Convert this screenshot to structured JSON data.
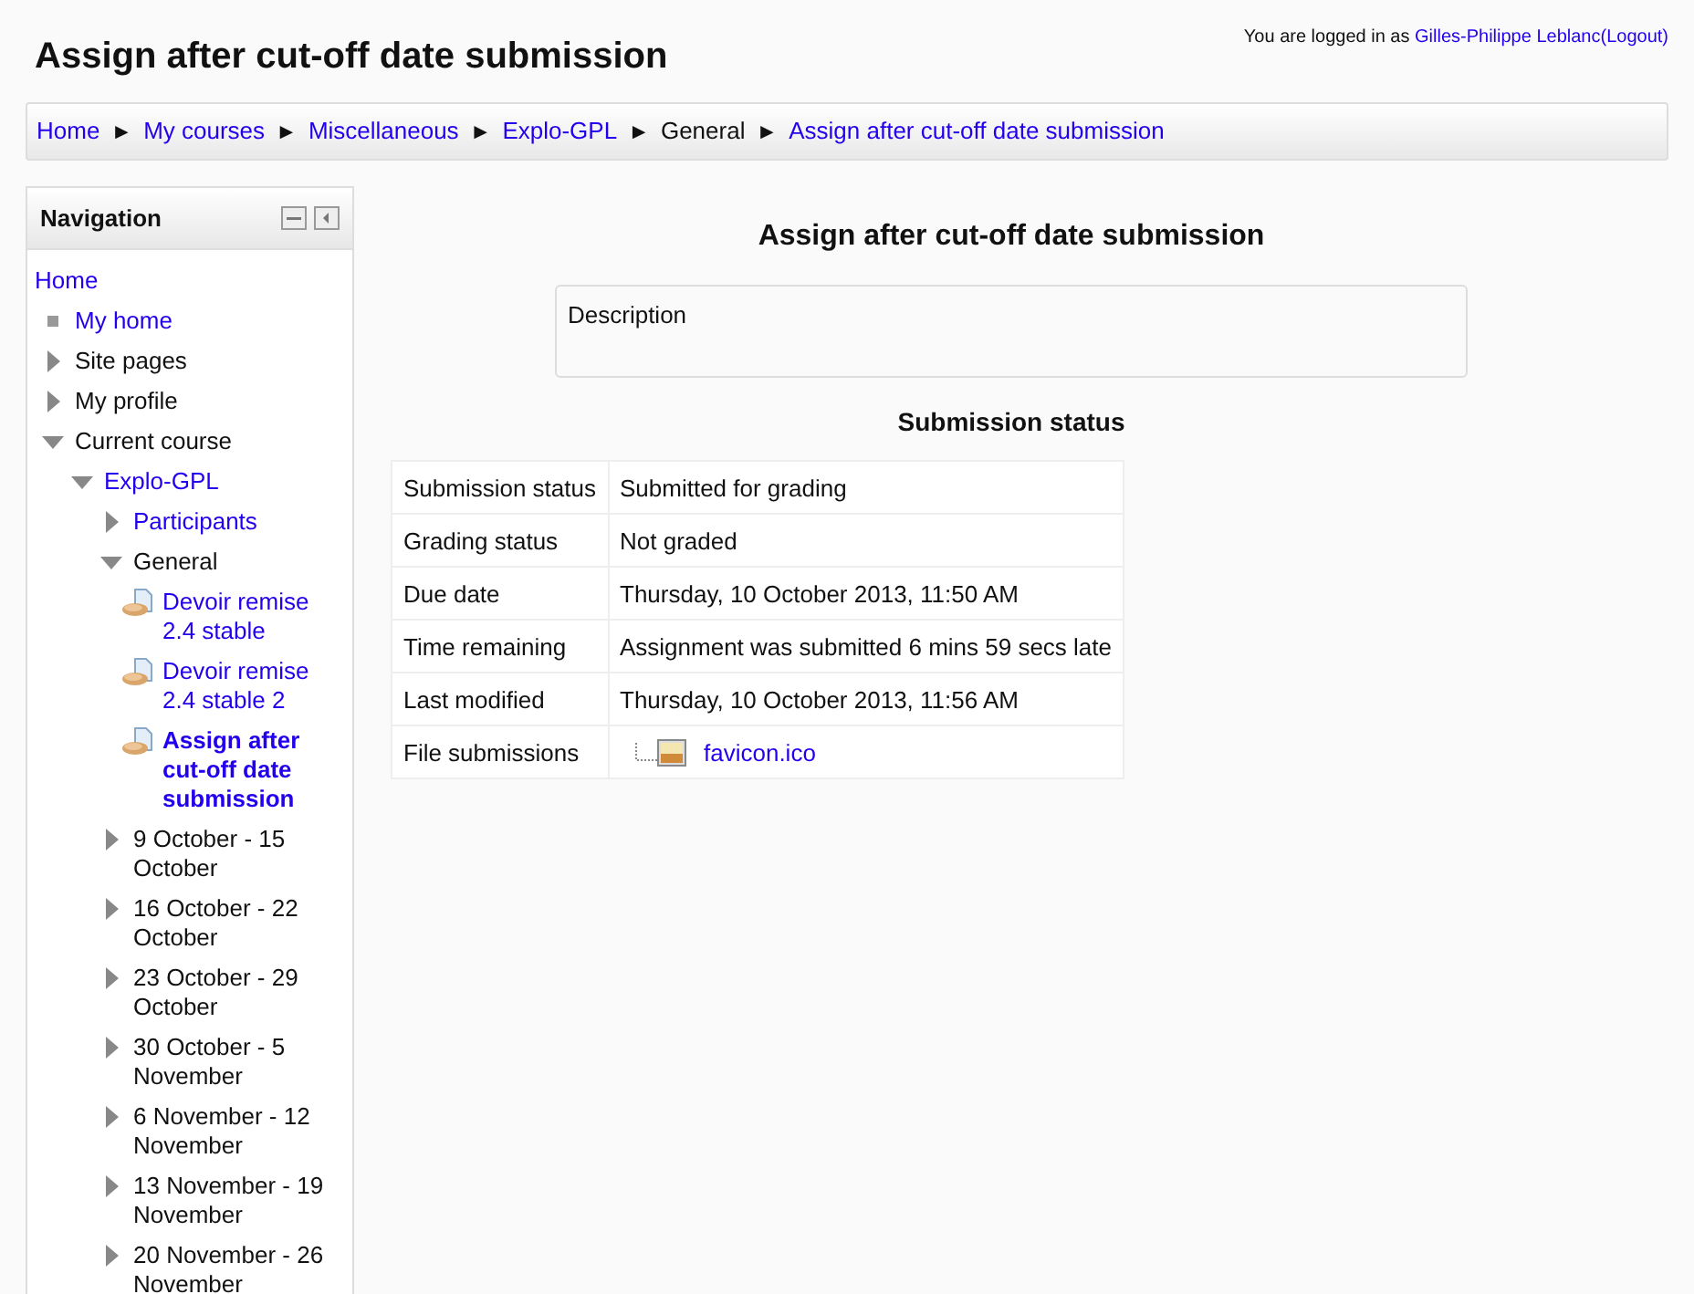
{
  "header": {
    "title": "Assign after cut-off date submission",
    "login_prefix": "You are logged in as",
    "user": "Gilles-Philippe Leblanc",
    "logout": "(Logout)"
  },
  "breadcrumb": [
    {
      "label": "Home",
      "link": true
    },
    {
      "label": "My courses",
      "link": true
    },
    {
      "label": "Miscellaneous",
      "link": true
    },
    {
      "label": "Explo-GPL",
      "link": true
    },
    {
      "label": "General",
      "link": false
    },
    {
      "label": "Assign after cut-off date submission",
      "link": true
    }
  ],
  "breadcrumb_separator": "►",
  "navigation": {
    "title": "Navigation",
    "items": [
      {
        "label": "Home",
        "kind": "root",
        "link": true
      },
      {
        "label": "My home",
        "kind": "leaf",
        "link": true
      },
      {
        "label": "Site pages",
        "kind": "branch",
        "link": false,
        "expanded": false
      },
      {
        "label": "My profile",
        "kind": "branch",
        "link": false,
        "expanded": false
      },
      {
        "label": "Current course",
        "kind": "branch",
        "link": false,
        "expanded": true,
        "children": [
          {
            "label": "Explo-GPL",
            "kind": "branch",
            "link": true,
            "expanded": true,
            "children": [
              {
                "label": "Participants",
                "kind": "branch",
                "link": true,
                "expanded": false
              },
              {
                "label": "General",
                "kind": "branch",
                "link": false,
                "expanded": true,
                "children": [
                  {
                    "label": "Devoir remise 2.4 stable",
                    "kind": "activity",
                    "link": true,
                    "current": false
                  },
                  {
                    "label": "Devoir remise 2.4 stable 2",
                    "kind": "activity",
                    "link": true,
                    "current": false
                  },
                  {
                    "label": "Assign after cut-off date submission",
                    "kind": "activity",
                    "link": true,
                    "current": true
                  }
                ]
              },
              {
                "label": "9 October - 15 October",
                "kind": "branch",
                "link": false,
                "expanded": false
              },
              {
                "label": "16 October - 22 October",
                "kind": "branch",
                "link": false,
                "expanded": false
              },
              {
                "label": "23 October - 29 October",
                "kind": "branch",
                "link": false,
                "expanded": false
              },
              {
                "label": "30 October - 5 November",
                "kind": "branch",
                "link": false,
                "expanded": false
              },
              {
                "label": "6 November - 12 November",
                "kind": "branch",
                "link": false,
                "expanded": false
              },
              {
                "label": "13 November - 19 November",
                "kind": "branch",
                "link": false,
                "expanded": false
              },
              {
                "label": "20 November - 26 November",
                "kind": "branch",
                "link": false,
                "expanded": false
              }
            ]
          }
        ]
      }
    ]
  },
  "main": {
    "heading": "Assign after cut-off date submission",
    "description": "Description",
    "status_heading": "Submission status",
    "rows": [
      {
        "label": "Submission status",
        "value": "Submitted for grading",
        "kind": "text"
      },
      {
        "label": "Grading status",
        "value": "Not graded",
        "kind": "text"
      },
      {
        "label": "Due date",
        "value": "Thursday, 10 October 2013, 11:50 AM",
        "kind": "text"
      },
      {
        "label": "Time remaining",
        "value": "Assignment was submitted 6 mins 59 secs late",
        "kind": "text"
      },
      {
        "label": "Last modified",
        "value": "Thursday, 10 October 2013, 11:56 AM",
        "kind": "text"
      },
      {
        "label": "File submissions",
        "value": "favicon.ico",
        "kind": "file"
      }
    ]
  }
}
